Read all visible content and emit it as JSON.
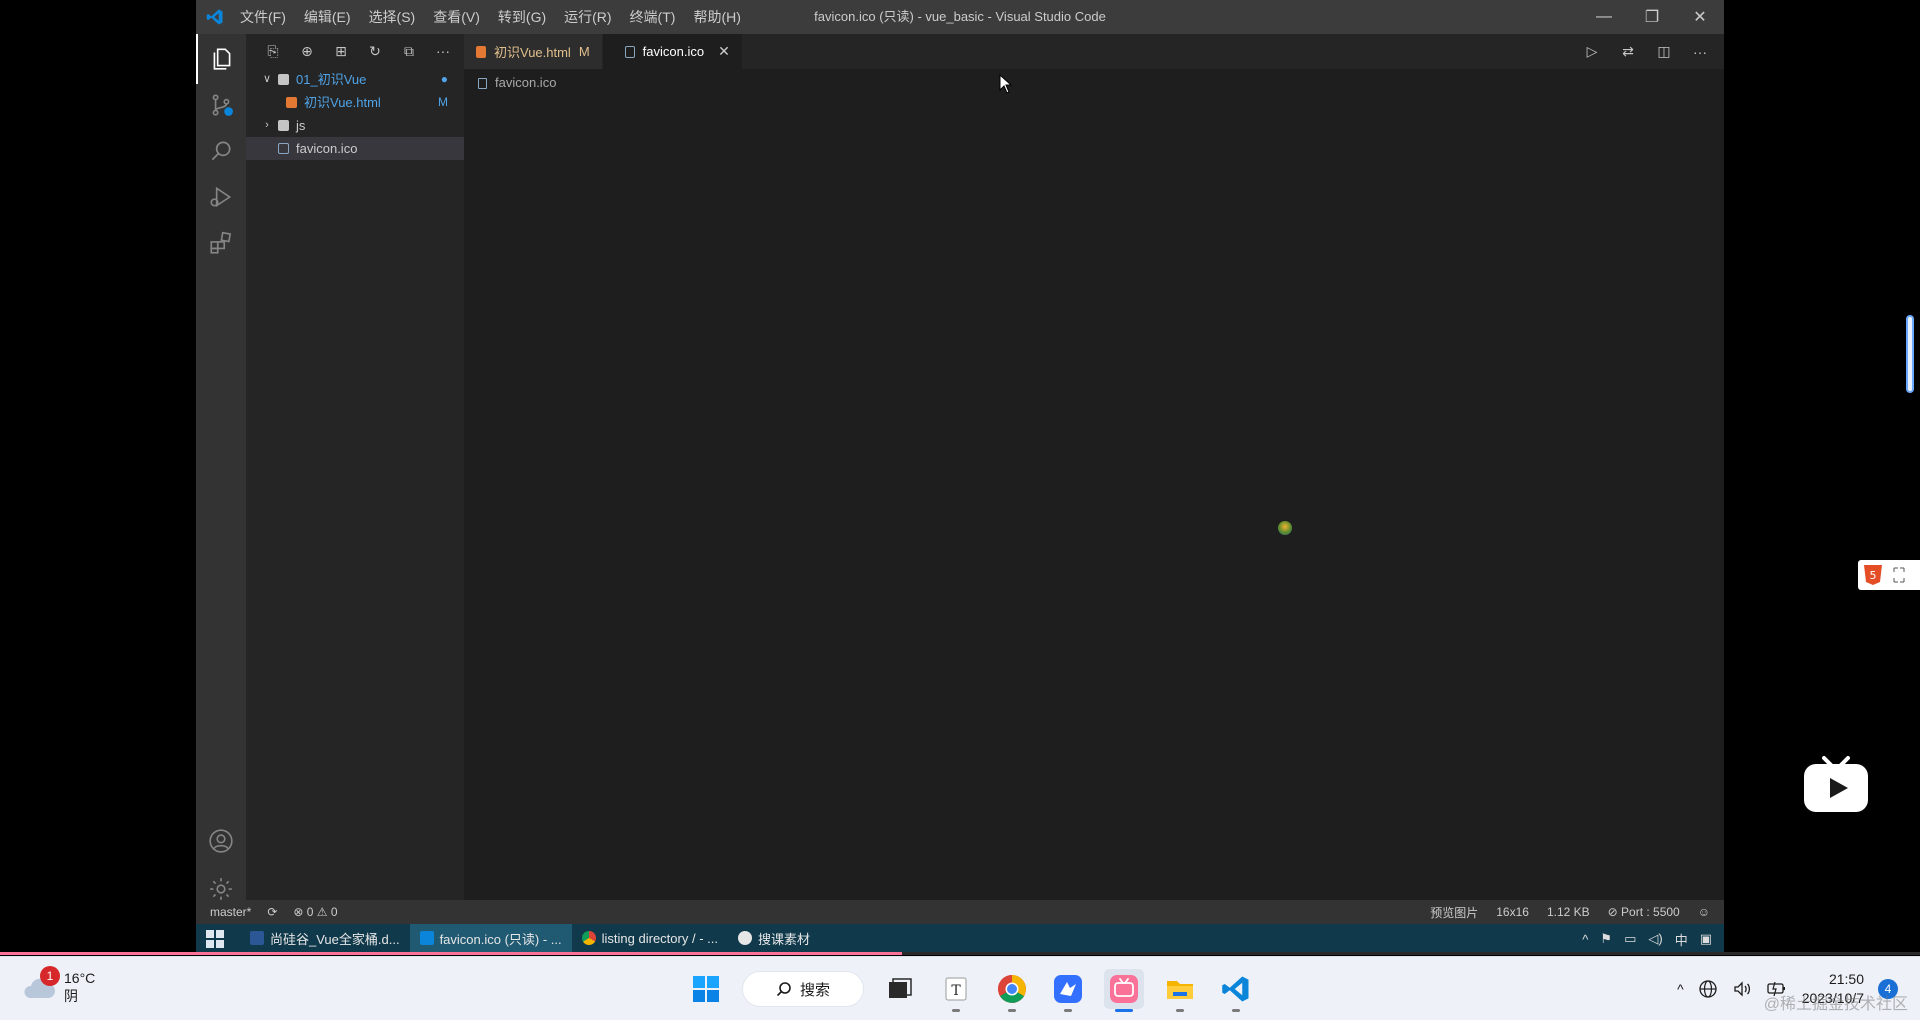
{
  "vscode": {
    "menu": [
      "文件(F)",
      "编辑(E)",
      "选择(S)",
      "查看(V)",
      "转到(G)",
      "运行(R)",
      "终端(T)",
      "帮助(H)"
    ],
    "window_title": "favicon.ico (只读) - vue_basic - Visual Studio Code",
    "win_controls": {
      "minimize": "—",
      "restore": "❐",
      "close": "✕"
    },
    "explorer": {
      "toolbar": [
        "⎘",
        "⊕",
        "⊞",
        "↻",
        "⧉",
        "···"
      ],
      "tree": [
        {
          "label": "01_初识Vue",
          "chevron": "∨",
          "badge": "●",
          "color": "#4fa3e6"
        },
        {
          "label": "初识Vue.html",
          "badge": "M",
          "color": "#4fa3e6"
        },
        {
          "label": "js",
          "chevron": "›",
          "badge": "",
          "color": "#cccccc"
        },
        {
          "label": "favicon.ico",
          "badge": "",
          "color": "#cccccc"
        }
      ]
    },
    "tabs": [
      {
        "label": "初识Vue.html",
        "suffix": "M"
      },
      {
        "label": "favicon.ico",
        "close": "✕"
      }
    ],
    "editor_actions": [
      "▷",
      "⇄",
      "◫",
      "···"
    ],
    "breadcrumb": "favicon.ico",
    "status": {
      "branch": "master*",
      "sync": "⟳",
      "problems": "⊗ 0 ⚠ 0",
      "image_type": "预览图片",
      "dimensions": "16x16",
      "size": "1.12 KB",
      "port": "⊘ Port : 5500"
    }
  },
  "inner_taskbar": {
    "tasks": [
      "尚硅谷_Vue全家桶.d...",
      "favicon.ico (只读) - ...",
      "listing directory / - ...",
      "搜课素材"
    ],
    "tray": [
      "^",
      "⚑",
      "▭",
      "◁)",
      "中",
      "▣"
    ]
  },
  "progress": {
    "fraction": 0.47
  },
  "host_taskbar": {
    "weather": {
      "badge": "1",
      "temp": "16°C",
      "condition": "阴"
    },
    "search_label": "搜索",
    "apps": [
      "windows-start",
      "search",
      "task-view",
      "typora",
      "chrome",
      "feishu",
      "bilibili",
      "file-explorer",
      "vscode"
    ],
    "tray": {
      "chevron": "^",
      "time": "21:50",
      "date": "2023/10/7",
      "notifications": "4"
    }
  },
  "watermark": "@稀土掘金技术社区",
  "colors": {
    "vscode_blue": "#007acc",
    "bilibili_pink": "#fb7299",
    "modified": "#e2c08d"
  }
}
